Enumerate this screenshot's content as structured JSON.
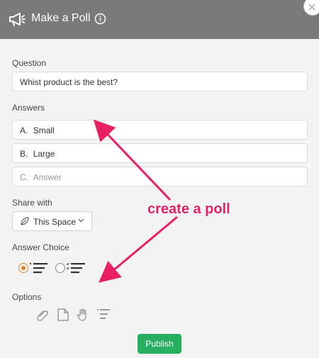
{
  "header": {
    "title": "Make a Poll",
    "info_icon": "info-icon",
    "megaphone_icon": "megaphone-icon",
    "close_icon": "close-icon"
  },
  "question": {
    "label": "Question",
    "value": "Whist product is the best?"
  },
  "answers": {
    "label": "Answers",
    "items": [
      {
        "prefix": "A.",
        "text": "Small",
        "is_placeholder": false
      },
      {
        "prefix": "B.",
        "text": "Large",
        "is_placeholder": false
      },
      {
        "prefix": "C.",
        "text": "Answer",
        "is_placeholder": true
      }
    ]
  },
  "share": {
    "label": "Share with",
    "value": "This Space",
    "icon": "leaf-icon"
  },
  "answer_choice": {
    "label": "Answer Choice",
    "options": [
      "single-choice",
      "multiple-choice"
    ],
    "selected": "single-choice"
  },
  "options": {
    "label": "Options",
    "icons": [
      "paperclip-icon",
      "document-icon",
      "hand-icon",
      "list-icon"
    ]
  },
  "publish": {
    "label": "Publish"
  },
  "annotation": {
    "text": "create a poll",
    "color": "#e91e63"
  },
  "colors": {
    "header": "#7a7a7a",
    "accent": "#e67e22",
    "publish": "#27ae60"
  }
}
